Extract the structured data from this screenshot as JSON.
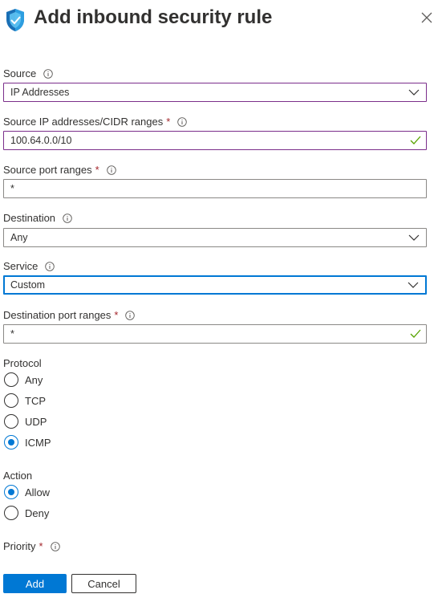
{
  "panel": {
    "title": "Add inbound security rule",
    "close_icon": "close-icon",
    "shield_icon": "security-shield-icon"
  },
  "form": {
    "source": {
      "label": "Source",
      "value": "IP Addresses"
    },
    "source_ip": {
      "label": "Source IP addresses/CIDR ranges",
      "required_mark": "*",
      "value": "100.64.0.0/10"
    },
    "source_port": {
      "label": "Source port ranges",
      "required_mark": "*",
      "value": "*"
    },
    "destination": {
      "label": "Destination",
      "value": "Any"
    },
    "service": {
      "label": "Service",
      "value": "Custom"
    },
    "dest_port": {
      "label": "Destination port ranges",
      "required_mark": "*",
      "value": "*"
    },
    "protocol": {
      "label": "Protocol",
      "options": [
        "Any",
        "TCP",
        "UDP",
        "ICMP"
      ],
      "selected": "ICMP"
    },
    "action": {
      "label": "Action",
      "options": [
        "Allow",
        "Deny"
      ],
      "selected": "Allow"
    },
    "priority": {
      "label": "Priority",
      "required_mark": "*"
    }
  },
  "footer": {
    "add_label": "Add",
    "cancel_label": "Cancel"
  },
  "colors": {
    "accent": "#0078d4",
    "valid_check": "#57a300",
    "required": "#a4262c",
    "purple_border": "#7b2e8b"
  }
}
